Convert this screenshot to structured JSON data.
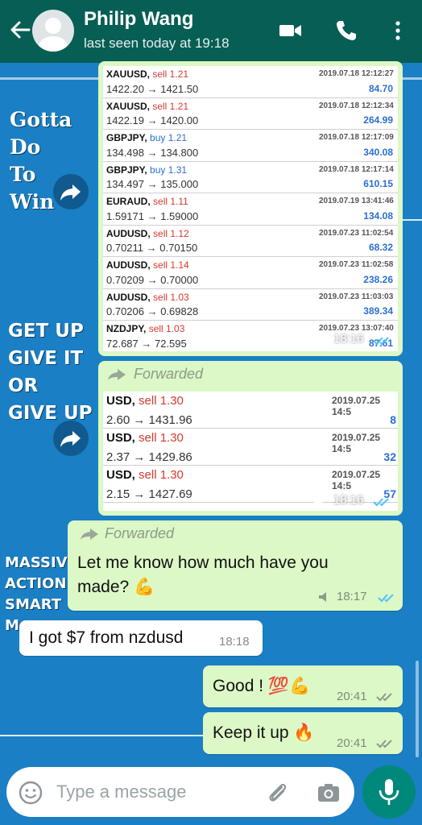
{
  "header": {
    "contact_name": "Philip Wang",
    "last_seen": "last seen today at 19:18",
    "bg_color": "#075e54"
  },
  "wallpaper": {
    "phrase1": [
      "Gotta",
      "Do",
      "To",
      "Win"
    ],
    "phrase2": [
      "GET UP",
      "GIVE IT",
      "OR",
      "GIVE UP"
    ],
    "phrase3": [
      "MASSIV",
      "ACTION",
      "SMART",
      "M"
    ]
  },
  "image1": {
    "trades": [
      {
        "pair": "XAUUSD,",
        "side": "sell",
        "lots": "1.21",
        "prices": "1422.20 → 1421.50",
        "date": "2019.07.18 12:12:27",
        "profit": "84.70"
      },
      {
        "pair": "XAUUSD,",
        "side": "sell",
        "lots": "1.21",
        "prices": "1422.19 → 1420.00",
        "date": "2019.07.18 12:12:34",
        "profit": "264.99"
      },
      {
        "pair": "GBPJPY,",
        "side": "buy",
        "lots": "1.21",
        "prices": "134.498 → 134.800",
        "date": "2019.07.18 12:17:09",
        "profit": "340.08"
      },
      {
        "pair": "GBPJPY,",
        "side": "buy",
        "lots": "1.31",
        "prices": "134.497 → 135.000",
        "date": "2019.07.18 12:17:14",
        "profit": "610.15"
      },
      {
        "pair": "EURAUD,",
        "side": "sell",
        "lots": "1.11",
        "prices": "1.59171 → 1.59000",
        "date": "2019.07.19 13:41:46",
        "profit": "134.08"
      },
      {
        "pair": "AUDUSD,",
        "side": "sell",
        "lots": "1.12",
        "prices": "0.70211 → 0.70150",
        "date": "2019.07.23 11:02:54",
        "profit": "68.32"
      },
      {
        "pair": "AUDUSD,",
        "side": "sell",
        "lots": "1.14",
        "prices": "0.70209 → 0.70000",
        "date": "2019.07.23 11:02:58",
        "profit": "238.26"
      },
      {
        "pair": "AUDUSD,",
        "side": "sell",
        "lots": "1.03",
        "prices": "0.70206 → 0.69828",
        "date": "2019.07.23 11:03:03",
        "profit": "389.34"
      },
      {
        "pair": "NZDJPY,",
        "side": "sell",
        "lots": "1.03",
        "prices": "72.687 → 72.595",
        "date": "2019.07.23 13:07:40",
        "profit": "87.61"
      }
    ],
    "time": "18:16"
  },
  "image2": {
    "forwarded_label": "Forwarded",
    "trades": [
      {
        "pair": "USD,",
        "side": "sell",
        "lots": "1.30",
        "prices": "2.60 → 1431.96",
        "date": "2019.07.25 14:5",
        "profit": "8"
      },
      {
        "pair": "USD,",
        "side": "sell",
        "lots": "1.30",
        "prices": "2.37 → 1429.86",
        "date": "2019.07.25 14:5",
        "profit": "32"
      },
      {
        "pair": "USD,",
        "side": "sell",
        "lots": "1.30",
        "prices": "2.15 → 1427.69",
        "date": "2019.07.25 14:5",
        "profit": "57"
      }
    ],
    "time": "18:16"
  },
  "messages": [
    {
      "dir": "out",
      "forwarded_label": "Forwarded",
      "text_line1": "Let me know how much have you",
      "text_line2": "made?",
      "emoji": "💪",
      "time": "18:17"
    },
    {
      "dir": "in",
      "text": "I got $7 from nzdusd",
      "time": "18:18"
    },
    {
      "dir": "out",
      "text": "Good !",
      "emoji": "💯💪",
      "time": "20:41"
    },
    {
      "dir": "out",
      "text": "Keep it up",
      "emoji": "🔥",
      "time": "20:41"
    }
  ],
  "input": {
    "placeholder": "Type a message"
  },
  "colors": {
    "wallpaper": "#1a7fc4",
    "outgoing_bubble": "#dcf8c6",
    "incoming_bubble": "#ffffff",
    "read_ticks": "#4fc3f7",
    "mic_button": "#00897b"
  }
}
